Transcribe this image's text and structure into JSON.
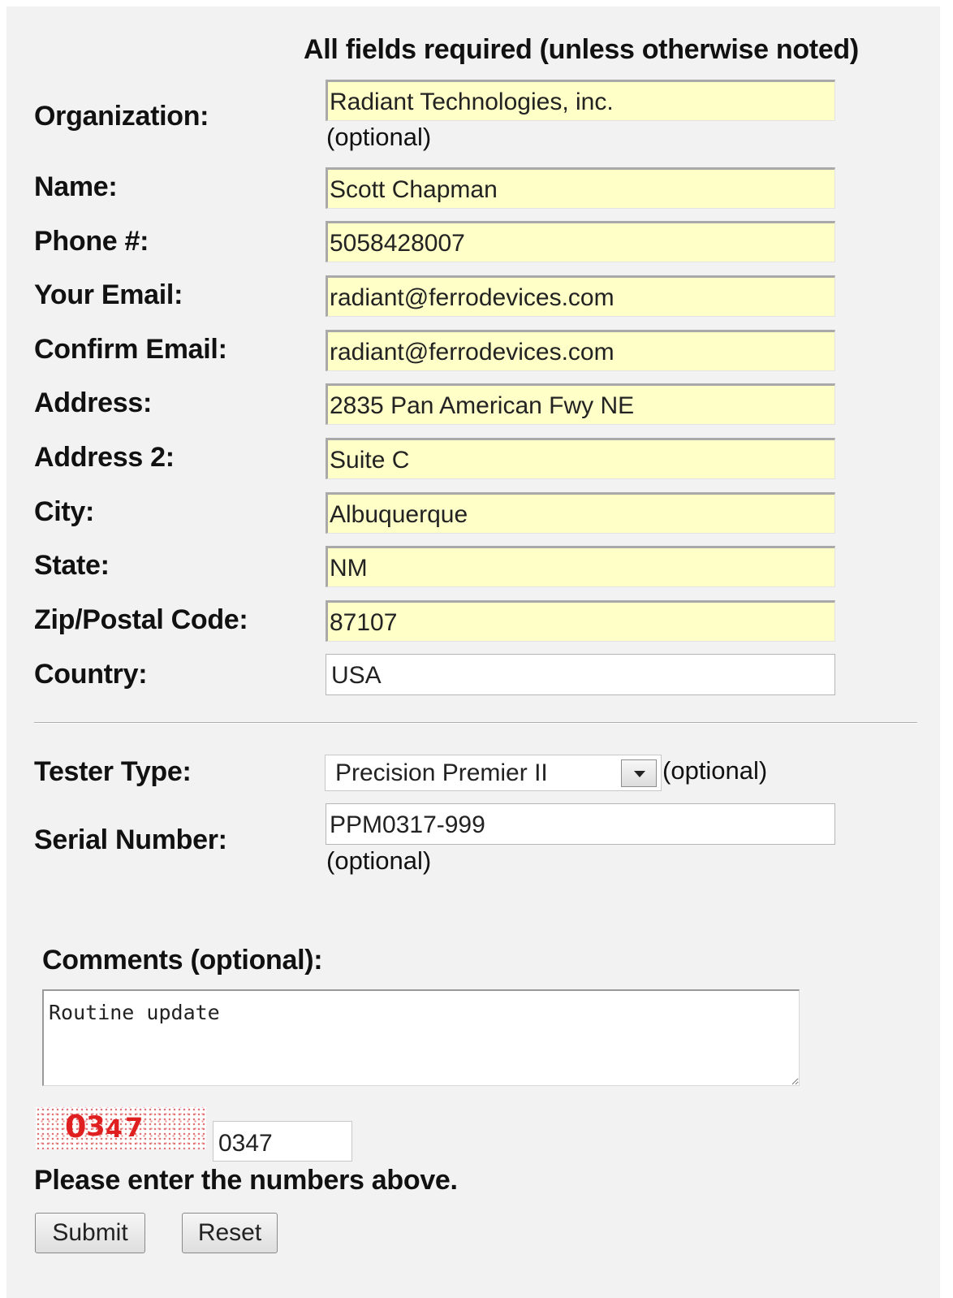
{
  "header": "All fields required (unless otherwise noted)",
  "optional_note": "(optional)",
  "fields": {
    "organization": {
      "label": "Organization:",
      "value": "Radiant Technologies, inc."
    },
    "name": {
      "label": "Name:",
      "value": "Scott Chapman"
    },
    "phone": {
      "label": "Phone #:",
      "value": "5058428007"
    },
    "email": {
      "label": "Your Email:",
      "value": "radiant@ferrodevices.com"
    },
    "confirm_email": {
      "label": "Confirm Email:",
      "value": "radiant@ferrodevices.com"
    },
    "address": {
      "label": "Address:",
      "value": "2835 Pan American Fwy NE"
    },
    "address2": {
      "label": "Address 2:",
      "value": "Suite C"
    },
    "city": {
      "label": "City:",
      "value": "Albuquerque"
    },
    "state": {
      "label": "State:",
      "value": "NM"
    },
    "zip": {
      "label": "Zip/Postal Code:",
      "value": "87107"
    },
    "country": {
      "label": "Country:",
      "value": "USA"
    }
  },
  "tester_type": {
    "label": "Tester Type:",
    "selected": "Precision Premier II",
    "note": "(optional)"
  },
  "serial_number": {
    "label": "Serial Number:",
    "value": "PPM0317-999",
    "note": "(optional)"
  },
  "comments": {
    "label": "Comments (optional):",
    "value": "Routine update"
  },
  "captcha": {
    "digits": [
      "0",
      "3",
      "4",
      "7"
    ],
    "input_value": "0347",
    "prompt": "Please enter the numbers above."
  },
  "buttons": {
    "submit": "Submit",
    "reset": "Reset"
  },
  "colors": {
    "required_field_bg": "#ffffc8",
    "captcha_red": "#e02020",
    "panel_bg": "#f2f2f2"
  }
}
